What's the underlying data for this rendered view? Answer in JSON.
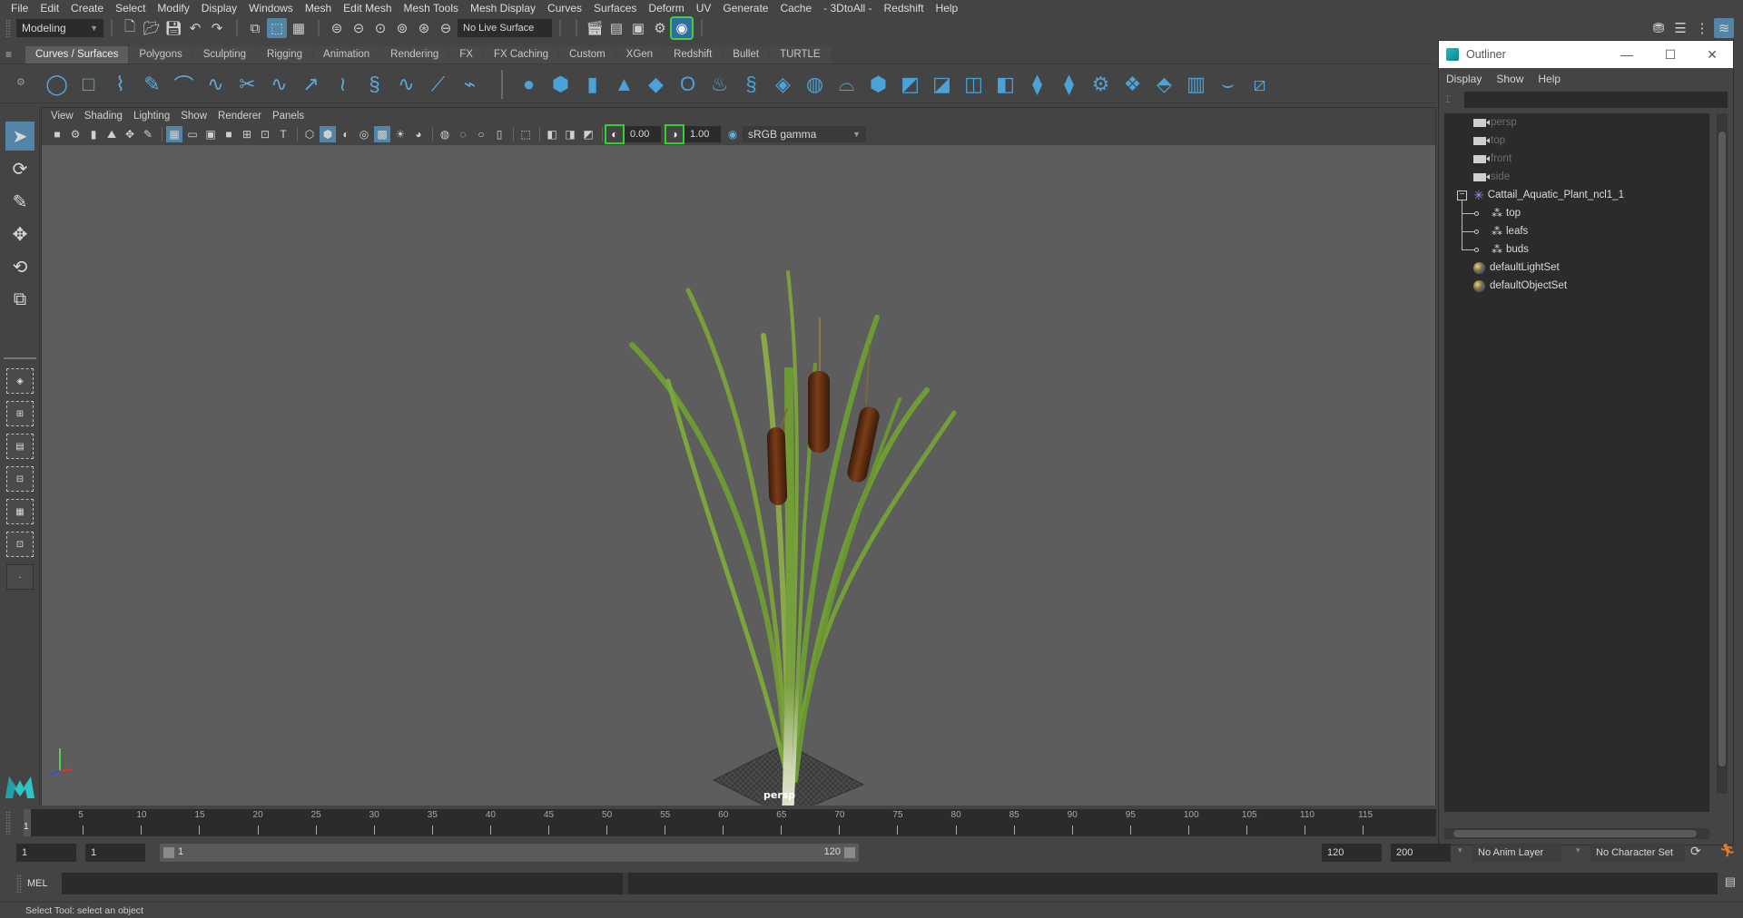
{
  "menubar": [
    "File",
    "Edit",
    "Create",
    "Select",
    "Modify",
    "Display",
    "Windows",
    "Mesh",
    "Edit Mesh",
    "Mesh Tools",
    "Mesh Display",
    "Curves",
    "Surfaces",
    "Deform",
    "UV",
    "Generate",
    "Cache",
    "- 3DtoAll -",
    "Redshift",
    "Help"
  ],
  "statusline": {
    "menuset": "Modeling",
    "live_surface": "No Live Surface",
    "icons": [
      "new-scene-icon",
      "open-scene-icon",
      "save-scene-icon",
      "undo-icon",
      "redo-icon",
      "select-hierarchy-icon",
      "select-object-icon",
      "select-component-icon",
      "snap-grid-icon",
      "snap-curve-icon",
      "snap-point-icon",
      "snap-view-plane-icon",
      "snap-live-icon",
      "render-current-frame-icon",
      "render-sequence-icon",
      "ipr-render-icon",
      "render-settings-icon",
      "hypershade-icon"
    ]
  },
  "shelf": {
    "tabs": [
      "Curves / Surfaces",
      "Polygons",
      "Sculpting",
      "Rigging",
      "Animation",
      "Rendering",
      "FX",
      "FX Caching",
      "Custom",
      "XGen",
      "Redshift",
      "Bullet",
      "TURTLE"
    ],
    "selected_tab": "Curves / Surfaces",
    "curve_tools": [
      {
        "name": "nurbs-circle-icon",
        "glyph": "◯"
      },
      {
        "name": "nurbs-square-icon",
        "glyph": "□"
      },
      {
        "name": "ep-curve-tool-icon",
        "glyph": "⌇"
      },
      {
        "name": "pencil-curve-tool-icon",
        "glyph": "✎"
      },
      {
        "name": "three-point-arc-icon",
        "glyph": "⌒"
      },
      {
        "name": "attach-curves-icon",
        "glyph": "∿"
      },
      {
        "name": "cut-curve-icon",
        "glyph": "✂"
      },
      {
        "name": "insert-knot-icon",
        "glyph": "∿"
      },
      {
        "name": "extend-curve-icon",
        "glyph": "↗"
      },
      {
        "name": "offset-curve-icon",
        "glyph": "≀"
      },
      {
        "name": "rebuild-curve-icon",
        "glyph": "§"
      },
      {
        "name": "add-points-tool-icon",
        "glyph": "∿"
      },
      {
        "name": "curve-editing-tool-icon",
        "glyph": "⟋"
      },
      {
        "name": "bezier-curve-tool-icon",
        "glyph": "⌁"
      }
    ],
    "surface_tools": [
      {
        "name": "nurbs-sphere-icon",
        "glyph": "●"
      },
      {
        "name": "nurbs-cube-icon",
        "glyph": "⬢"
      },
      {
        "name": "nurbs-cylinder-icon",
        "glyph": "▮"
      },
      {
        "name": "nurbs-cone-icon",
        "glyph": "▲"
      },
      {
        "name": "nurbs-plane-icon",
        "glyph": "◆"
      },
      {
        "name": "nurbs-torus-icon",
        "glyph": "O"
      },
      {
        "name": "revolve-icon",
        "glyph": "♨"
      },
      {
        "name": "loft-icon",
        "glyph": "§"
      },
      {
        "name": "planar-icon",
        "glyph": "◈"
      },
      {
        "name": "extrude-icon",
        "glyph": "◍"
      },
      {
        "name": "birail-icon",
        "glyph": "⌓"
      },
      {
        "name": "bevel-plus-icon",
        "glyph": "⬢"
      },
      {
        "name": "project-curve-icon",
        "glyph": "◩"
      },
      {
        "name": "intersect-surfaces-icon",
        "glyph": "◪"
      },
      {
        "name": "trim-tool-icon",
        "glyph": "◫"
      },
      {
        "name": "untrim-icon",
        "glyph": "◧"
      },
      {
        "name": "attach-surfaces-icon",
        "glyph": "⧫"
      },
      {
        "name": "detach-surfaces-icon",
        "glyph": "⧫"
      },
      {
        "name": "round-tool-icon",
        "glyph": "⚙"
      },
      {
        "name": "insert-isoparm-icon",
        "glyph": "❖"
      },
      {
        "name": "extend-surface-icon",
        "glyph": "⬘"
      },
      {
        "name": "rebuild-surface-icon",
        "glyph": "▥"
      },
      {
        "name": "sculpt-geometry-tool-icon",
        "glyph": "⌣"
      },
      {
        "name": "surface-editing-tool-icon",
        "glyph": "⧄"
      }
    ]
  },
  "panel": {
    "menus": [
      "View",
      "Shading",
      "Lighting",
      "Show",
      "Renderer",
      "Panels"
    ],
    "exposure": "0.00",
    "gamma": "1.00",
    "color_space": "sRGB gamma",
    "camera_label": "persp"
  },
  "outliner": {
    "title": "Outliner",
    "menus": [
      "Display",
      "Show",
      "Help"
    ],
    "filter_value": "",
    "items": [
      {
        "label": "persp",
        "type": "camera",
        "dim": true
      },
      {
        "label": "top",
        "type": "camera",
        "dim": true
      },
      {
        "label": "front",
        "type": "camera",
        "dim": true
      },
      {
        "label": "side",
        "type": "camera",
        "dim": true
      },
      {
        "label": "Cattail_Aquatic_Plant_ncl1_1",
        "type": "group",
        "expanded": true
      },
      {
        "label": "top",
        "type": "mesh",
        "child": true
      },
      {
        "label": "leafs",
        "type": "mesh",
        "child": true
      },
      {
        "label": "buds",
        "type": "mesh",
        "child": true
      },
      {
        "label": "defaultLightSet",
        "type": "set"
      },
      {
        "label": "defaultObjectSet",
        "type": "set"
      }
    ]
  },
  "timeslider": {
    "current_frame": "1",
    "ticks": [
      "5",
      "10",
      "15",
      "20",
      "25",
      "30",
      "35",
      "40",
      "45",
      "50",
      "55",
      "60",
      "65",
      "70",
      "75",
      "80",
      "85",
      "90",
      "95",
      "100",
      "105",
      "110",
      "115"
    ],
    "range_min": 1,
    "range_max": 120
  },
  "rangebar": {
    "start_time": "1",
    "playback_start": "1",
    "range_start_label": "1",
    "range_end_label": "120",
    "playback_end": "120",
    "end_time": "200",
    "anim_layer": "No Anim Layer",
    "character_set": "No Character Set"
  },
  "cmdline": {
    "language": "MEL",
    "input": "",
    "output": ""
  },
  "helpline": "Select Tool: select an object",
  "colors": {
    "accent": "#5285a6",
    "viewport_bg": "#5d5d5d",
    "panel_bg": "#444444",
    "field_bg": "#2b2b2b",
    "highlight_green": "#3fcf3f"
  }
}
